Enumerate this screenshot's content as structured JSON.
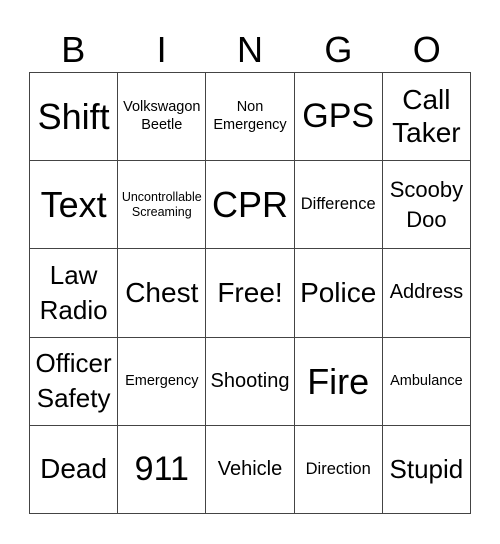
{
  "header": {
    "letters": [
      "B",
      "I",
      "N",
      "G",
      "O"
    ]
  },
  "board": {
    "rows": [
      [
        "Shift",
        "Volkswagon Beetle",
        "Non Emergency",
        "GPS",
        "Call Taker"
      ],
      [
        "Text",
        "Uncontrollable Screaming",
        "CPR",
        "Difference",
        "Scooby Doo"
      ],
      [
        "Law Radio",
        "Chest",
        "Free!",
        "Police",
        "Address"
      ],
      [
        "Officer Safety",
        "Emergency",
        "Shooting",
        "Fire",
        "Ambulance"
      ],
      [
        "Dead",
        "911",
        "Vehicle",
        "Direction",
        "Stupid"
      ]
    ]
  }
}
